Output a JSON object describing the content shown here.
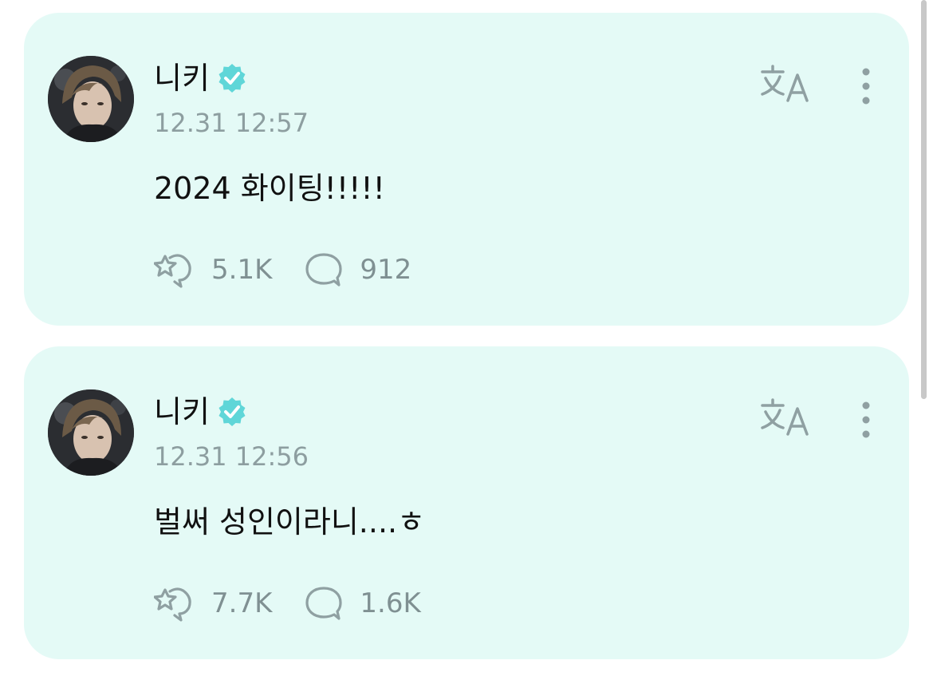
{
  "posts": [
    {
      "author": "니키",
      "timestamp": "12.31 12:57",
      "text": "2024 화이팅!!!!!",
      "likes": "5.1K",
      "comments": "912"
    },
    {
      "author": "니키",
      "timestamp": "12.31 12:56",
      "text": "벌써 성인이라니....ㅎ",
      "likes": "7.7K",
      "comments": "1.6K"
    }
  ],
  "icons": {
    "verified": "verified-badge-icon",
    "translate": "translate-icon",
    "more": "more-vertical-icon",
    "like": "like-icon",
    "comment": "comment-icon"
  },
  "colors": {
    "card_background": "#e4faf6",
    "verified_badge": "#5fd6d8",
    "icon_gray": "#8d9ea0"
  }
}
